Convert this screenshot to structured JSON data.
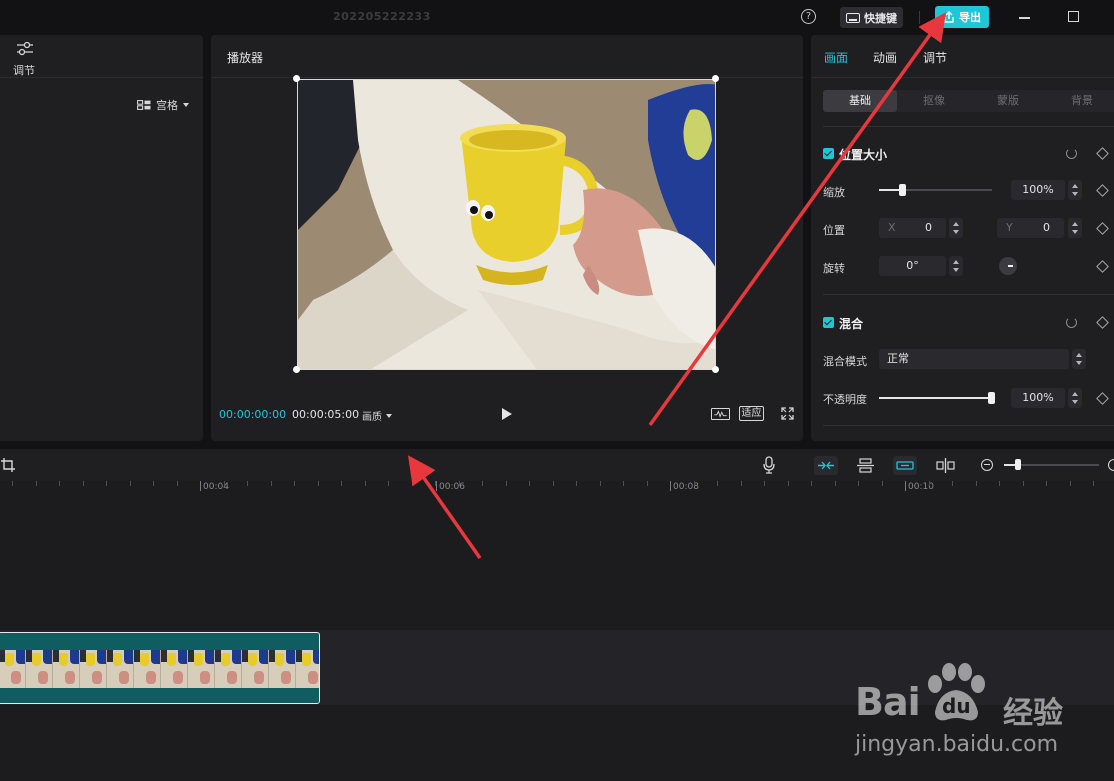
{
  "window": {
    "title": "202205222233",
    "help_glyph": "?",
    "shortcut_label": "快捷键",
    "export_label": "导出"
  },
  "left_panel": {
    "adjust_label": "调节",
    "layout_label": "宫格"
  },
  "player": {
    "title": "播放器",
    "current_time": "00:00:00:00",
    "total_time": "00:00:05:00",
    "quality_label": "画质",
    "fit_label": "适应"
  },
  "inspector": {
    "tabs": [
      "画面",
      "动画",
      "调节"
    ],
    "active_tab": "画面",
    "subtabs": [
      "基础",
      "抠像",
      "蒙版",
      "背景"
    ],
    "active_subtab": "基础",
    "position_size": {
      "title": "位置大小",
      "scale_label": "缩放",
      "scale_value": "100%",
      "scale_fraction": 0.2,
      "position_label": "位置",
      "x_placeholder": "X",
      "x_value": "0",
      "y_placeholder": "Y",
      "y_value": "0",
      "rotate_label": "旋转",
      "rotate_value": "0°"
    },
    "blend": {
      "title": "混合",
      "mode_label": "混合模式",
      "mode_value": "正常",
      "opacity_label": "不透明度",
      "opacity_value": "100%",
      "opacity_fraction": 1.0
    }
  },
  "timeline": {
    "ruler_labels": [
      "00:04",
      "00:06",
      "00:08",
      "00:10"
    ]
  },
  "watermark": {
    "logo_text": "Bai",
    "logo_text_2": "du",
    "logo_cn": "经验",
    "url": "jingyan.baidu.com"
  },
  "colors": {
    "accent": "#1fc6d6",
    "annotation_arrow": "#e8383d",
    "clip": "#0f5d61"
  }
}
